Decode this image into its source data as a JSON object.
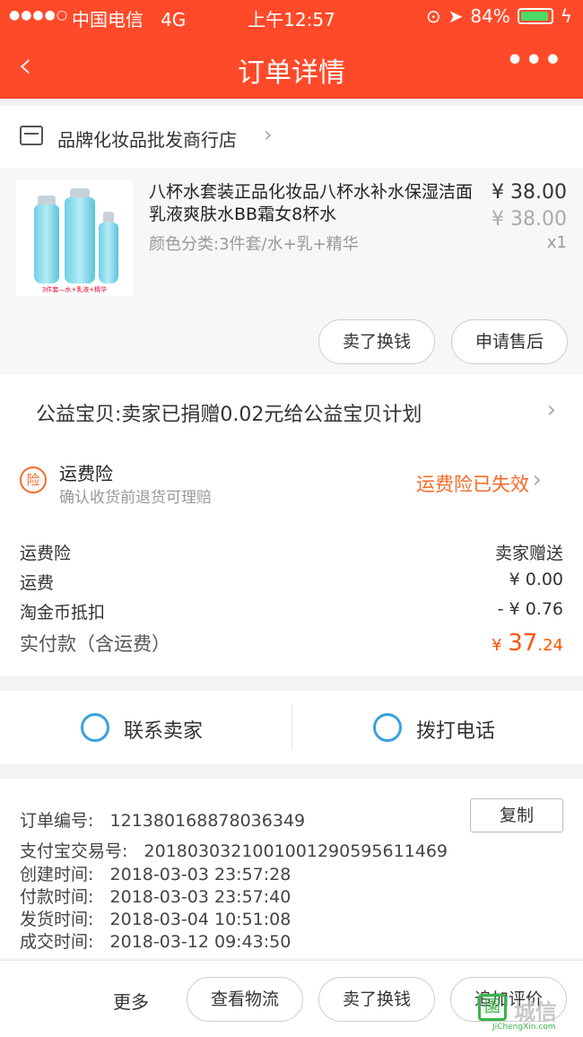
{
  "status_bar": {
    "signal": "●●●●○",
    "carrier": "中国电信",
    "network": "4G",
    "time": "上午12:57",
    "battery": "84%"
  },
  "nav": {
    "title": "订单详情",
    "back_icon": "‹",
    "more_icon": "•••"
  },
  "shop": {
    "name": "品牌化妆品批发商行店"
  },
  "product": {
    "title": "八杯水套装正品化妆品八杯水补水保湿洁面乳液爽肤水BB霜女8杯水",
    "sku": "颜色分类:3件套/水+乳+精华",
    "price": "¥ 38.00",
    "original_price": "¥ 38.00",
    "quantity": "x1",
    "thumb_caption": "3件套—水+乳液+精华",
    "sell_button": "卖了换钱",
    "after_sale_button": "申请售后"
  },
  "charity": {
    "text": "公益宝贝:卖家已捐赠0.02元给公益宝贝计划"
  },
  "insurance": {
    "badge": "险",
    "title": "运费险",
    "subtitle": "确认收货前退货可理赔",
    "status": "运费险已失效"
  },
  "fees": {
    "rows": [
      {
        "label": "运费险",
        "value": "卖家赠送"
      },
      {
        "label": "运费",
        "value": "¥ 0.00"
      },
      {
        "label": "淘金币抵扣",
        "value": "- ¥ 0.76"
      }
    ],
    "total_label": "实付款（含运费）",
    "total_currency": "¥",
    "total_int": "37",
    "total_dec": ".24"
  },
  "contact": {
    "seller_label": "联系卖家",
    "phone_label": "拨打电话"
  },
  "order_info": {
    "order_no_label": "订单编号:",
    "order_no": "121380168878036349",
    "copy_button": "复制",
    "alipay_label": "支付宝交易号:",
    "alipay_no": "2018030321001001290595611469",
    "created_label": "创建时间:",
    "created": "2018-03-03 23:57:28",
    "paid_label": "付款时间:",
    "paid": "2018-03-03 23:57:40",
    "shipped_label": "发货时间:",
    "shipped": "2018-03-04 10:51:08",
    "completed_label": "成交时间:",
    "completed": "2018-03-12 09:43:50"
  },
  "actions": {
    "more": "更多",
    "logistics": "查看物流",
    "sell": "卖了换钱",
    "review": "追加评价"
  },
  "watermark": {
    "text": "城信",
    "sub": "JiChengXin.com"
  },
  "colors": {
    "brand": "#ff4a2a",
    "accent": "#f76a27",
    "price_red": "#ff5500",
    "icon_blue": "#3aa0e0"
  }
}
